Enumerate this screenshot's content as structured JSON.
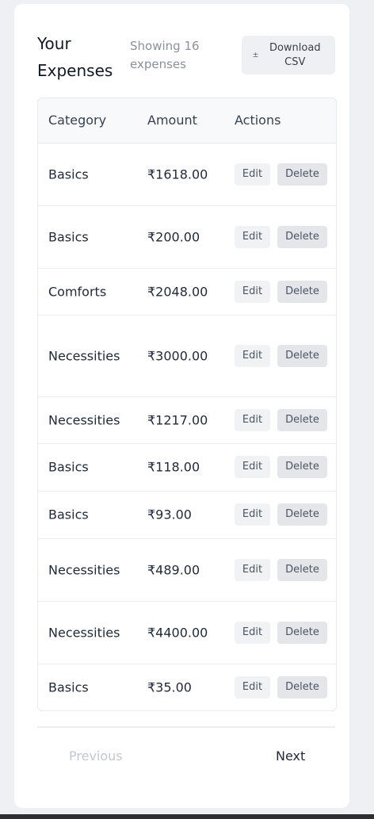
{
  "header": {
    "title": "Your Expenses",
    "showing": "Showing 16 expenses",
    "download_icon": "download-arrow-icon",
    "download_label": "Download CSV"
  },
  "table": {
    "columns": [
      "Category",
      "Amount",
      "Actions"
    ],
    "edit_label": "Edit",
    "delete_label": "Delete",
    "rows": [
      {
        "category": "Basics",
        "amount": "₹1618.00"
      },
      {
        "category": "Basics",
        "amount": "₹200.00"
      },
      {
        "category": "Comforts",
        "amount": "₹2048.00"
      },
      {
        "category": "Necessities",
        "amount": "₹3000.00"
      },
      {
        "category": "Necessities",
        "amount": "₹1217.00"
      },
      {
        "category": "Basics",
        "amount": "₹118.00"
      },
      {
        "category": "Basics",
        "amount": "₹93.00"
      },
      {
        "category": "Necessities",
        "amount": "₹489.00"
      },
      {
        "category": "Necessities",
        "amount": "₹4400.00"
      },
      {
        "category": "Basics",
        "amount": "₹35.00"
      }
    ]
  },
  "pagination": {
    "previous_label": "Previous",
    "next_label": "Next"
  }
}
